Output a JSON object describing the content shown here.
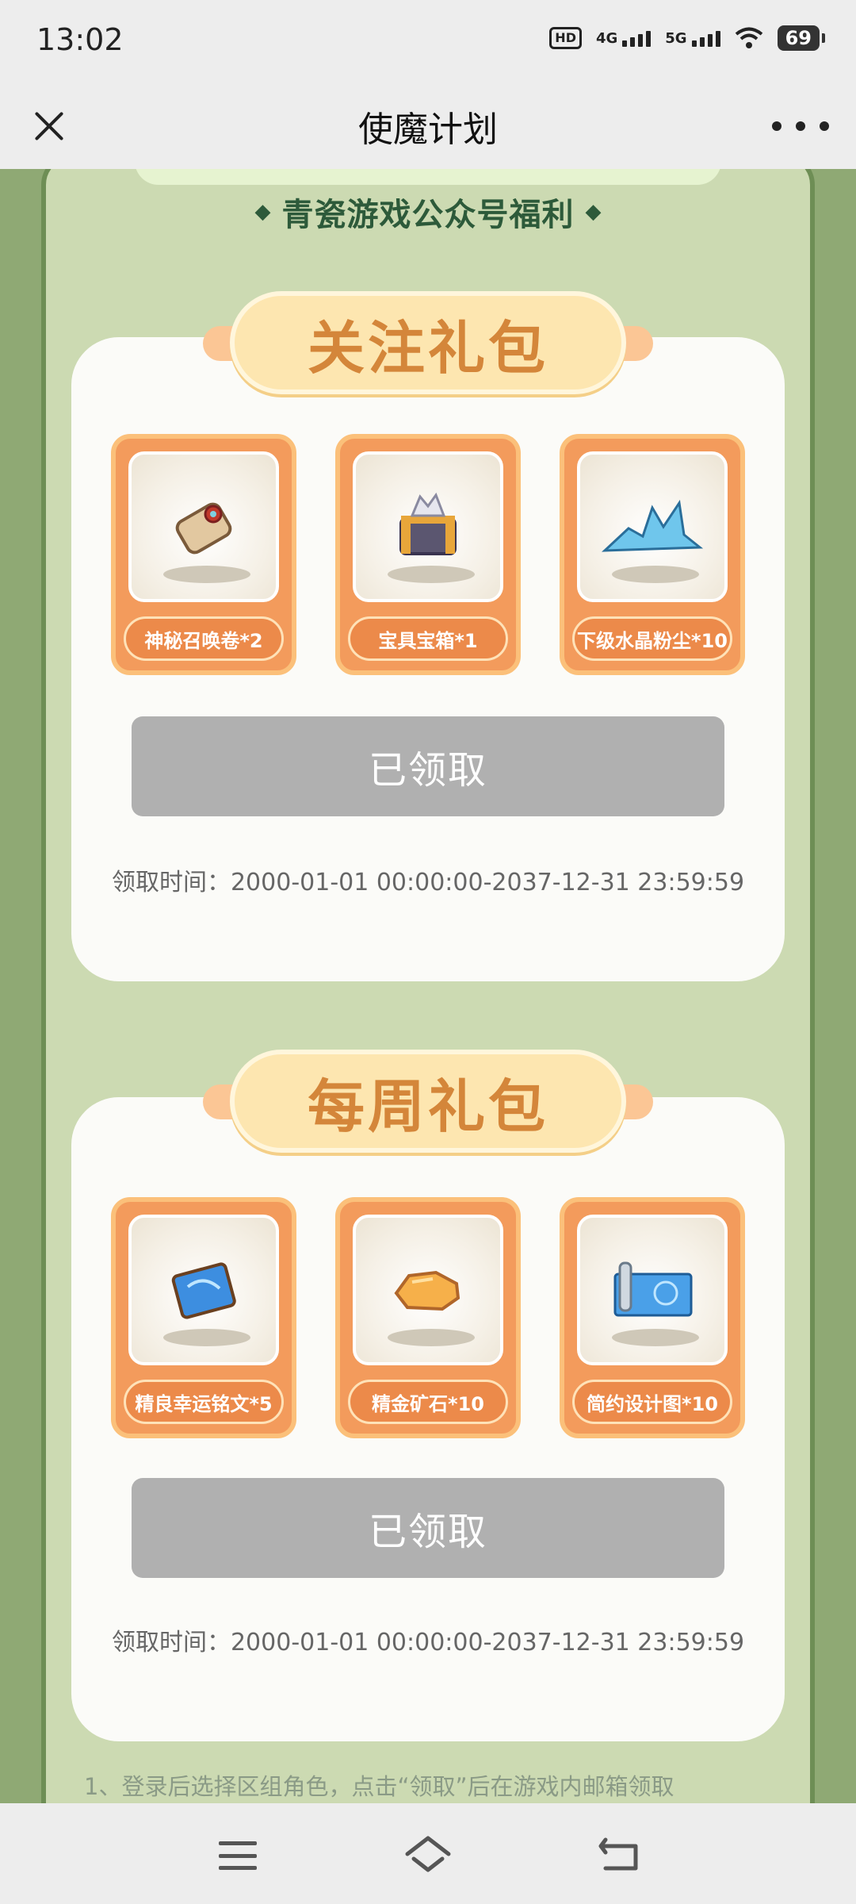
{
  "status_bar": {
    "time": "13:02",
    "hd_label": "HD",
    "signal_1_label": "4G",
    "signal_2_label": "5G",
    "battery": "69"
  },
  "header": {
    "title": "使魔计划"
  },
  "banner": {
    "subtitle": "青瓷游戏公众号福利"
  },
  "cards": [
    {
      "title": "关注礼包",
      "items": [
        {
          "label": "神秘召唤卷*2",
          "icon": "scroll-icon"
        },
        {
          "label": "宝具宝箱*1",
          "icon": "treasure-chest-icon"
        },
        {
          "label": "下级水晶粉尘*10",
          "icon": "crystal-dust-icon"
        }
      ],
      "button_label": "已领取",
      "claim_time": "领取时间：2000-01-01 00:00:00-2037-12-31 23:59:59"
    },
    {
      "title": "每周礼包",
      "items": [
        {
          "label": "精良幸运铭文*5",
          "icon": "blue-scroll-icon"
        },
        {
          "label": "精金矿石*10",
          "icon": "gold-ore-icon"
        },
        {
          "label": "简约设计图*10",
          "icon": "blueprint-icon"
        }
      ],
      "button_label": "已领取",
      "claim_time": "领取时间：2000-01-01 00:00:00-2037-12-31 23:59:59"
    }
  ],
  "note": "1、登录后选择区组角色，点击“领取”后在游戏内邮箱领取",
  "nav": {
    "menu_icon": "menu-icon",
    "home_icon": "home-icon",
    "back_icon": "back-icon"
  },
  "colors": {
    "accent_orange": "#f39b5c",
    "title_brown": "#d4863a",
    "disabled_gray": "#b0b0b0",
    "panel_green": "#ccdab2",
    "subtitle_green": "#2d5a3a"
  }
}
